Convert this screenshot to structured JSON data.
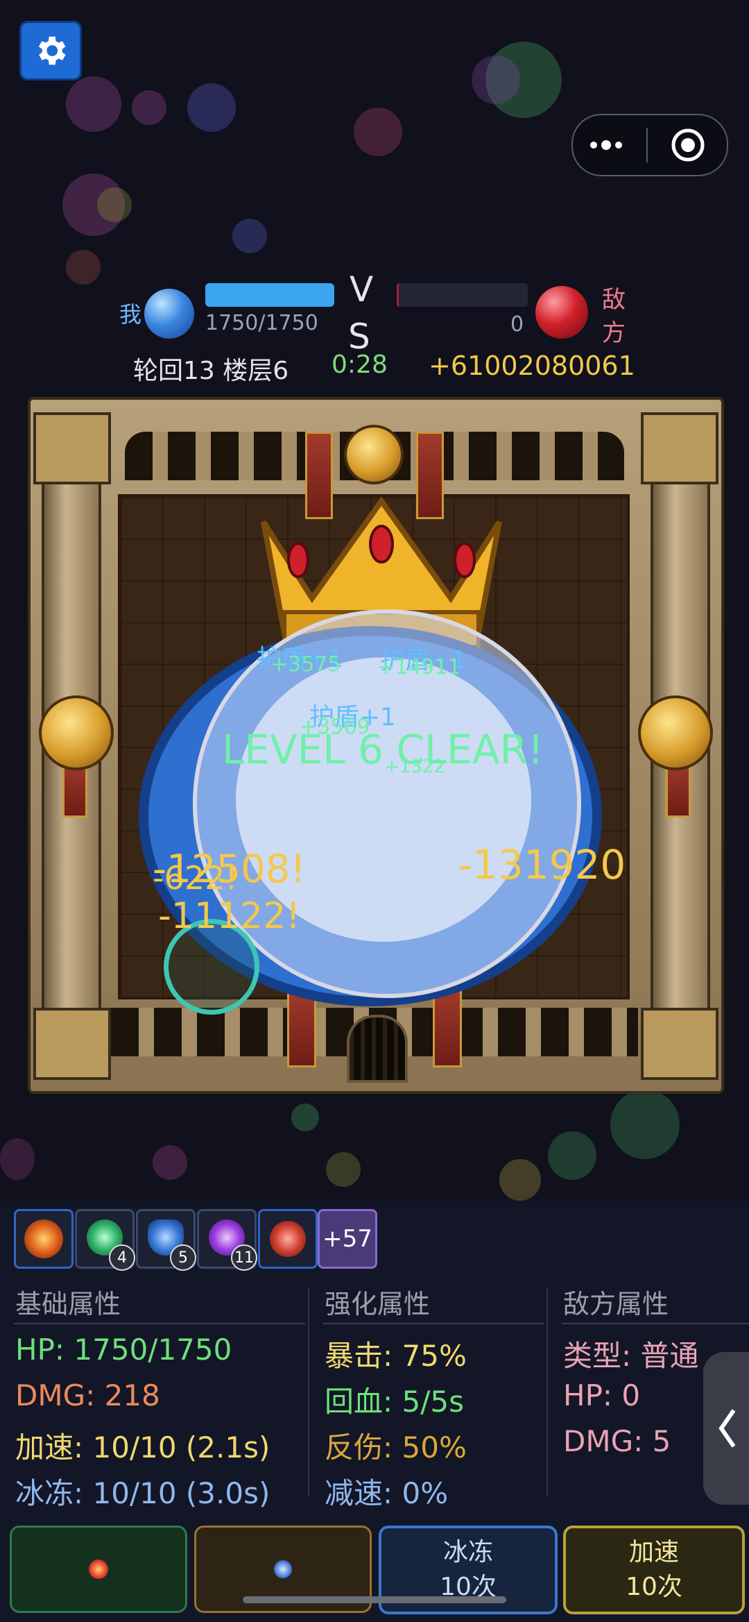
{
  "hud": {
    "player_label": "我",
    "player_hp_text": "1750/1750",
    "vs_v": "V",
    "vs_s": "S",
    "enemy_label_1": "敌",
    "enemy_label_2": "方",
    "enemy_hp_value": "0",
    "round_floor": "轮回13 楼层6",
    "timer": "0:28",
    "score": "+61002080061",
    "player_hp_fraction": 1.0,
    "enemy_hp_fraction": 0.0
  },
  "arena": {
    "level_clear": "LEVEL 6 CLEAR!",
    "floats": {
      "shield_1": "护盾+1",
      "shield_2": "护盾+1",
      "shield_3": "护盾+1",
      "heal_1": "+3575",
      "heal_2": "+14911",
      "heal_3": "+3569",
      "heal_4": "+1322",
      "dmg_1": "-12508!",
      "dmg_2": "-622!",
      "dmg_3": "-11122!",
      "dmg_4": "-131920"
    }
  },
  "skills": {
    "badge_2": "4",
    "badge_3": "5",
    "badge_4": "11",
    "more": "+57"
  },
  "stats": {
    "base": {
      "title": "基础属性",
      "hp": "HP: 1750/1750",
      "dmg": "DMG: 218",
      "haste": "加速: 10/10 (2.1s)",
      "freeze": "冰冻: 10/10 (3.0s)"
    },
    "enhance": {
      "title": "强化属性",
      "crit": "暴击: 75%",
      "regen": "回血: 5/5s",
      "reflect": "反伤: 50%",
      "slow": "减速: 0%"
    },
    "enemy": {
      "title": "敌方属性",
      "type": "类型: 普通",
      "hp": "HP: 0",
      "dmg": "DMG: 5"
    }
  },
  "buttons": {
    "freeze_line1": "冰冻",
    "freeze_line2": "10次",
    "haste_line1": "加速",
    "haste_line2": "10次"
  },
  "colors": {
    "background": "#10111d",
    "hp_bar": "#3aa6f0",
    "clear_text": "#6ff0a8",
    "damage_text": "#f4c84a",
    "stat_green": "#6ee07a",
    "stat_orange": "#ec8a5c",
    "stat_yellow": "#f1d870",
    "stat_blue": "#8fb8ee",
    "enemy_pink": "#e9a3b4"
  }
}
